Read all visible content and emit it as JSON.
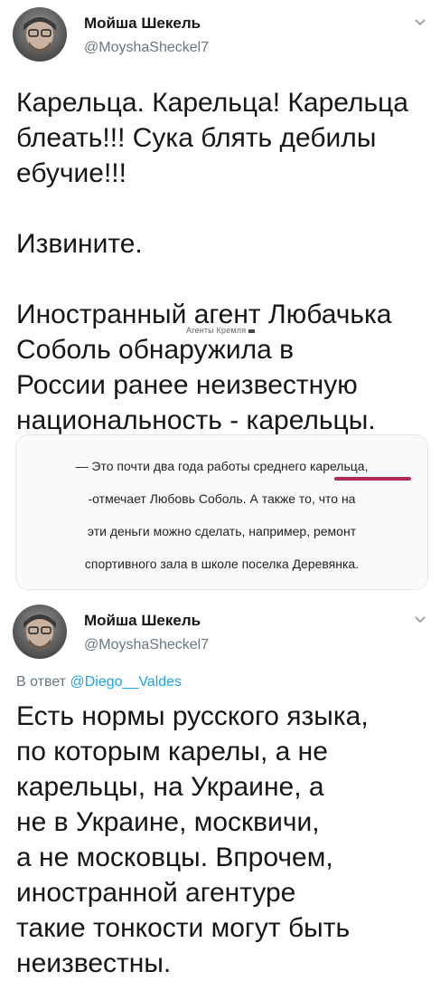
{
  "tweet1": {
    "author_name": "Мойша Шекель",
    "handle": "@MoyshaSheckel7",
    "chevron_icon": "chevron-down-icon",
    "paragraphs": [
      [
        "Карельца. Карельца! Карельца",
        "блеать!!! Сука блять дебилы",
        "ебучие!!!"
      ],
      [
        "Извините."
      ],
      [
        "Иностранный агент Любачька",
        "Соболь обнаружила в",
        "России ранее неизвестную",
        "национальность - карельцы."
      ]
    ],
    "overlay_label": "Агенты Кремля"
  },
  "quote": {
    "lines": [
      "— Это почти два года работы среднего карельца,",
      "-отмечает Любовь Соболь. А также то, что на",
      "эти деньги можно сделать, например, ремонт",
      "спортивного зала в школе поселка Деревянка."
    ],
    "underline_color": "#b0285c"
  },
  "tweet2": {
    "author_name": "Мойша Шекель",
    "handle": "@MoyshaSheckel7",
    "chevron_icon": "chevron-down-icon",
    "reply_prefix": "В ответ",
    "reply_to": "@Diego__Valdes",
    "lines": [
      "Есть нормы русского языка,",
      "по которым карелы, а не",
      "карельцы, на Украине, а",
      "не в Украине, москвичи,",
      "а не московцы. Впрочем,",
      "иностранной агентуре",
      "такие тонкости могут быть",
      "неизвестны."
    ]
  }
}
